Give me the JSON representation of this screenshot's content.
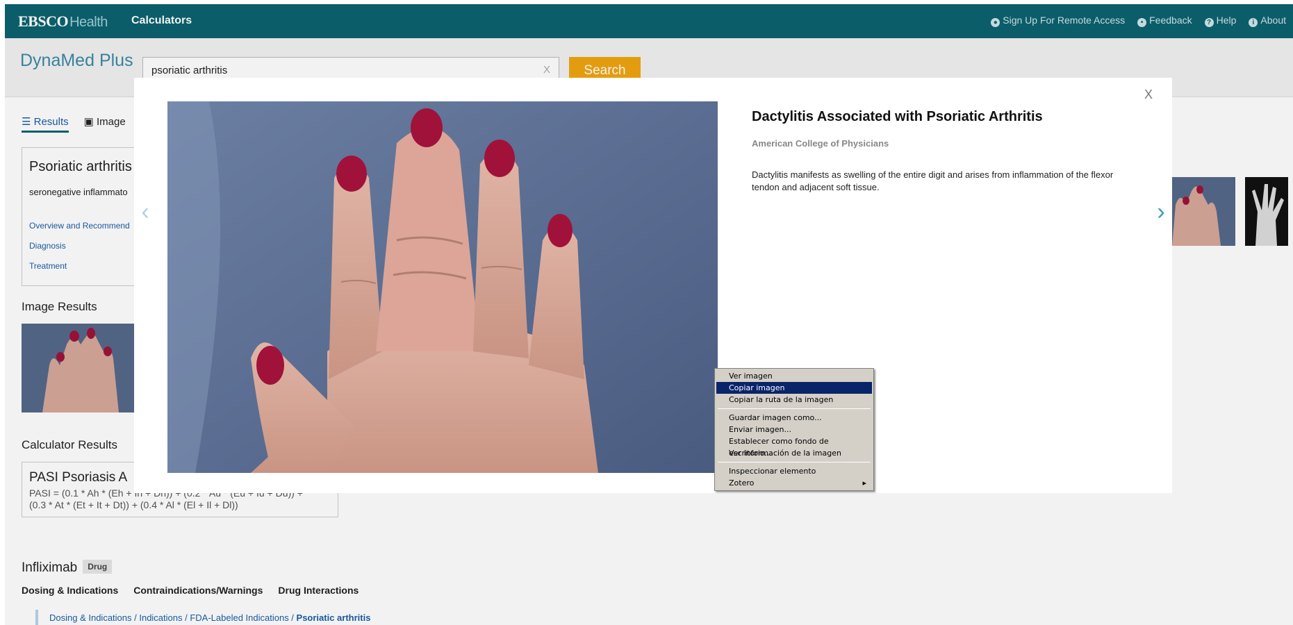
{
  "header": {
    "brand_main": "EBSCO",
    "brand_sub": "Health",
    "nav_calculators": "Calculators",
    "links": [
      {
        "icon": "person-icon",
        "label": "Sign Up For Remote Access"
      },
      {
        "icon": "speech-bubble-icon",
        "label": "Feedback"
      },
      {
        "icon": "question-circle-icon",
        "label": "Help"
      },
      {
        "icon": "info-circle-icon",
        "label": "About"
      }
    ]
  },
  "search": {
    "product": "DynaMed Plus",
    "query": "psoriatic arthritis",
    "clear_label": "X",
    "button_label": "Search"
  },
  "background": {
    "tabs": [
      "Results",
      "Image"
    ],
    "topic_title": "Psoriatic arthritis",
    "topic_desc": "seronegative inflammato",
    "topic_links": [
      "Overview and Recommend",
      "Diagnosis",
      "Treatment"
    ],
    "image_results_heading": "Image Results",
    "calculator_heading": "Calculator Results",
    "calc_title": "PASI Psoriasis A",
    "calc_line1": "PASI = (0.1 * Ah * (Eh + Ih + Dh)) + (0.2 * Au * (Eu + Iu + Du)) +",
    "calc_line2": "(0.3 * At * (Et + It + Dt)) + (0.4 * Al * (El + Il + Dl))",
    "drug_name": "Infliximab",
    "drug_badge": "Drug",
    "drug_links": [
      "Dosing & Indications",
      "Contraindications/Warnings",
      "Drug Interactions"
    ],
    "breadcrumb": "Dosing & Indications / Indications / FDA-Labeled Indications / ",
    "breadcrumb_current": "Psoriatic arthritis"
  },
  "modal": {
    "close_label": "X",
    "title": "Dactylitis Associated with Psoriatic Arthritis",
    "source": "American College of Physicians",
    "description": "Dactylitis manifests as swelling of the entire digit and arises from inflammation of the flexor tendon and adjacent soft tissue.",
    "prev_icon": "chevron-left-icon",
    "next_icon": "chevron-right-icon"
  },
  "context_menu": {
    "groups": [
      [
        "Ver imagen",
        "Copiar imagen",
        "Copiar la ruta de la imagen"
      ],
      [
        "Guardar imagen como...",
        "Enviar imagen...",
        "Establecer como fondo de escritorio...",
        "Ver información de la imagen"
      ],
      [
        "Inspeccionar elemento",
        "Zotero"
      ]
    ],
    "selected": "Copiar imagen",
    "submenu_item": "Zotero"
  },
  "colors": {
    "header_bg": "#0d6270",
    "search_button": "#f1a510",
    "link": "#1a5ea8",
    "menu_selection": "#0a246a"
  }
}
